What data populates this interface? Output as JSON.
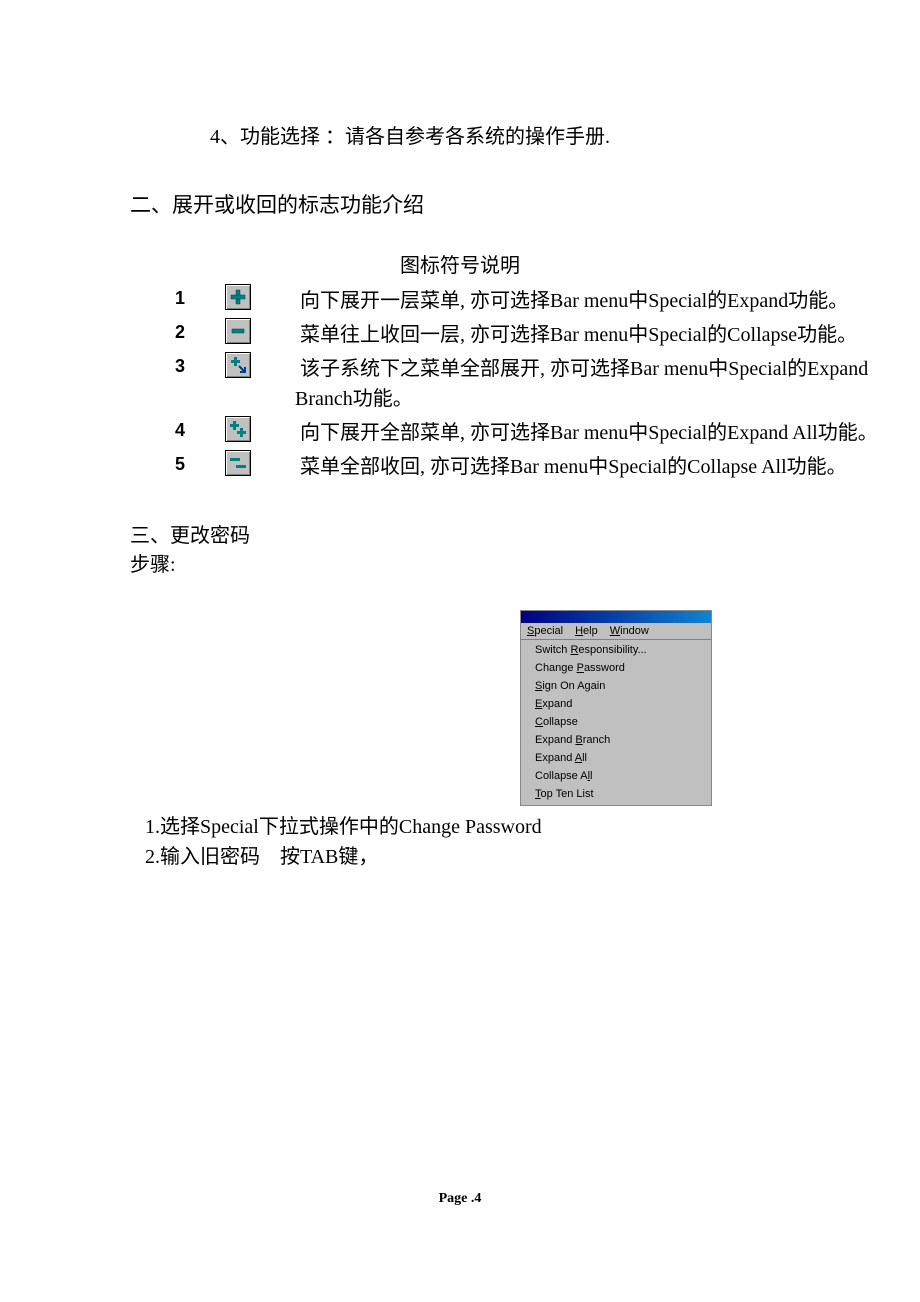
{
  "intro_line": "4、功能选择 ：请各自参考各系统的操作手册.",
  "section2_title": "二、展开或收回的标志功能介绍",
  "icon_table_caption": "图标符号说明",
  "icons": [
    {
      "num": "1",
      "name": "expand-icon",
      "desc": "向下展开一层菜单, 亦可选择Bar menu中Special的Expand功能。"
    },
    {
      "num": "2",
      "name": "collapse-icon",
      "desc": "菜单往上收回一层, 亦可选择Bar menu中Special的Collapse功能。"
    },
    {
      "num": "3",
      "name": "expand-branch-icon",
      "desc": "该子系统下之菜单全部展开, 亦可选择Bar menu中Special的Expand Branch功能。"
    },
    {
      "num": "4",
      "name": "expand-all-icon",
      "desc": "向下展开全部菜单, 亦可选择Bar menu中Special的Expand All功能。"
    },
    {
      "num": "5",
      "name": "collapse-all-icon",
      "desc": "菜单全部收回, 亦可选择Bar menu中Special的Collapse All功能。"
    }
  ],
  "section3_title": "三、更改密码",
  "section3_sub": "步骤:",
  "menu": {
    "bar": [
      {
        "full": "Special",
        "u": "S",
        "rest": "pecial"
      },
      {
        "full": "Help",
        "u": "H",
        "rest": "elp"
      },
      {
        "full": "Window",
        "u": "W",
        "rest": "indow"
      }
    ],
    "items": [
      {
        "pre": "Switch ",
        "u": "R",
        "post": "esponsibility..."
      },
      {
        "pre": "Change ",
        "u": "P",
        "post": "assword"
      },
      {
        "pre": "",
        "u": "S",
        "post": "ign On Again"
      },
      {
        "pre": "",
        "u": "E",
        "post": "xpand"
      },
      {
        "pre": "",
        "u": "C",
        "post": "ollapse"
      },
      {
        "pre": "Expand ",
        "u": "B",
        "post": "ranch"
      },
      {
        "pre": "Expand ",
        "u": "A",
        "post": "ll"
      },
      {
        "pre": "Collapse A",
        "u": "l",
        "post": "l"
      },
      {
        "pre": "",
        "u": "T",
        "post": "op Ten List"
      }
    ]
  },
  "steps": [
    "1.选择Special下拉式操作中的Change Password",
    "2.输入旧密码　按TAB键，"
  ],
  "footer": "Page .4"
}
